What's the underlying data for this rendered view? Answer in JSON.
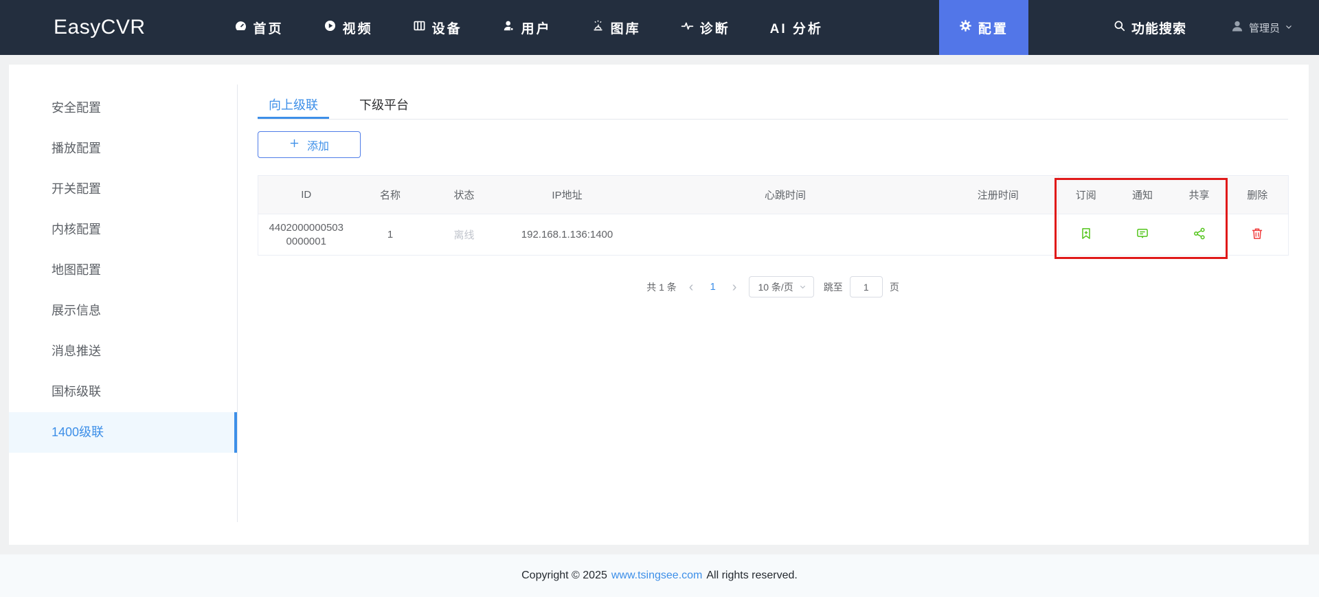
{
  "navbar": {
    "logo": "EasyCVR",
    "items": [
      {
        "label": "首页",
        "icon": "dashboard-icon"
      },
      {
        "label": "视频",
        "icon": "video-icon"
      },
      {
        "label": "设备",
        "icon": "device-icon"
      },
      {
        "label": "用户",
        "icon": "user-icon"
      },
      {
        "label": "图库",
        "icon": "alarm-gallery-icon"
      },
      {
        "label": "诊断",
        "icon": "pulse-icon"
      },
      {
        "label": "AI 分析",
        "icon": "none"
      },
      {
        "label": "配置",
        "icon": "gear-icon",
        "active": true
      }
    ],
    "search_label": "功能搜索",
    "user_label": "管理员"
  },
  "sidebar": {
    "items": [
      {
        "label": "安全配置"
      },
      {
        "label": "播放配置"
      },
      {
        "label": "开关配置"
      },
      {
        "label": "内核配置"
      },
      {
        "label": "地图配置"
      },
      {
        "label": "展示信息"
      },
      {
        "label": "消息推送"
      },
      {
        "label": "国标级联"
      },
      {
        "label": "1400级联",
        "active": true
      }
    ]
  },
  "main": {
    "tabs": [
      {
        "label": "向上级联",
        "active": true
      },
      {
        "label": "下级平台"
      }
    ],
    "add_button_label": "添加",
    "table": {
      "headers": [
        "ID",
        "名称",
        "状态",
        "IP地址",
        "心跳时间",
        "注册时间",
        "订阅",
        "通知",
        "共享",
        "删除"
      ],
      "rows": [
        {
          "id": "44020000005030000001",
          "name": "1",
          "status": "离线",
          "ip": "192.168.1.136:1400",
          "heartbeat_time": "",
          "register_time": ""
        }
      ]
    },
    "pagination": {
      "total_label": "共 1 条",
      "current_page": "1",
      "page_size_label": "10 条/页",
      "jump_prefix": "跳至",
      "jump_value": "1",
      "jump_suffix": "页"
    }
  },
  "footer": {
    "prefix": "Copyright © 2025",
    "link": "www.tsingsee.com",
    "suffix": "All rights reserved."
  },
  "colors": {
    "navbar_bg": "#232e3e",
    "nav_active_bg": "#5276e8",
    "accent_blue": "#3d8fe8",
    "action_green": "#52c41a",
    "delete_red": "#f03b3b",
    "highlight_box_red": "#e01919",
    "offline_gray": "#c0c4cc"
  }
}
